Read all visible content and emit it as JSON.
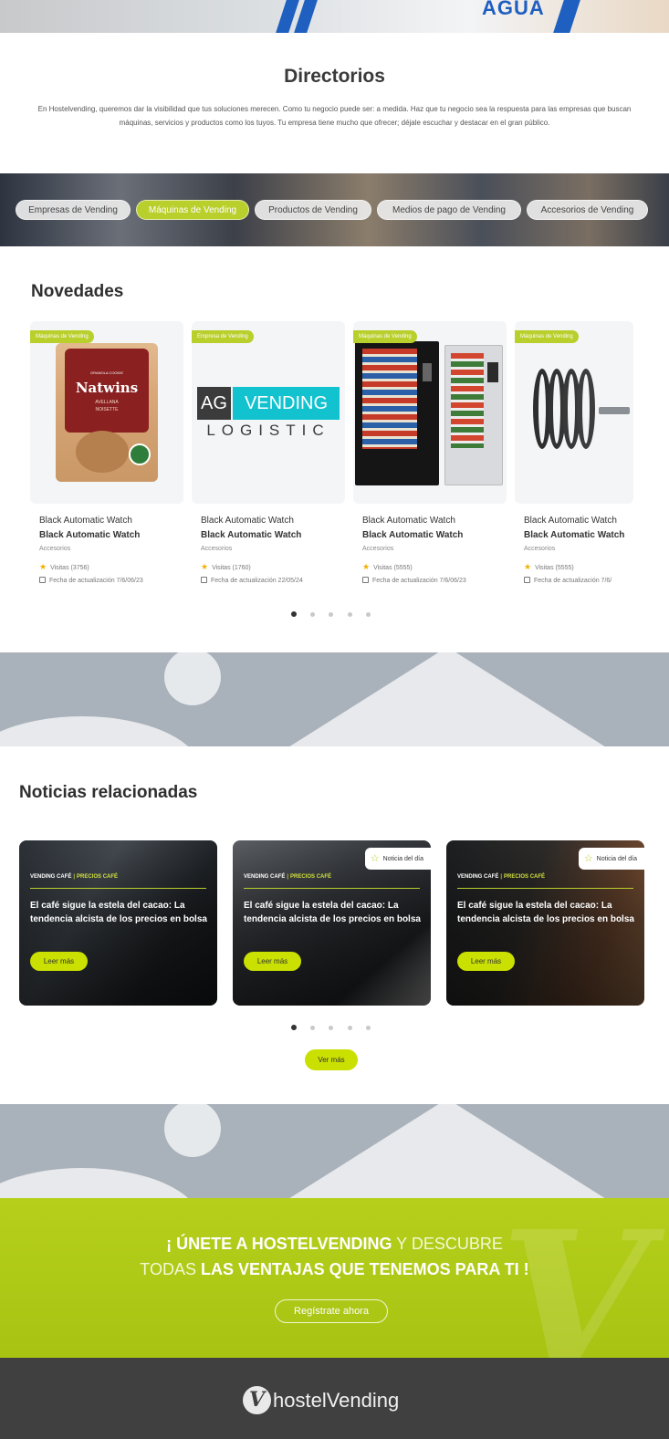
{
  "top_banner": {
    "text": "AGUA"
  },
  "directorios": {
    "title": "Directorios",
    "text": "En Hostelvending, queremos dar la visibilidad que tus soluciones merecen. Como tu negocio puede ser: a medida. Haz que tu negocio sea la respuesta para las empresas que buscan máquinas, servicios y productos como los tuyos. Tu empresa tiene mucho que ofrecer; déjale escuchar y destacar en el gran público."
  },
  "categories": [
    {
      "label": "Empresas de Vending",
      "active": false
    },
    {
      "label": "Máquinas de Vending",
      "active": true
    },
    {
      "label": "Productos de Vending",
      "active": false
    },
    {
      "label": "Medios de pago de Vending",
      "active": false
    },
    {
      "label": "Accesorios de Vending",
      "active": false
    }
  ],
  "novedades": {
    "title": "Novedades",
    "items": [
      {
        "badge": "Máquinas de Vending",
        "title": "Black Automatic Watch",
        "subtitle": "Black Automatic Watch",
        "category": "Accesorios",
        "visits": "Visitas (3756)",
        "date": "Fecha de actualización 7/6/06/23",
        "image": "natwins-product"
      },
      {
        "badge": "Empresa de Vending",
        "title": "Black Automatic Watch",
        "subtitle": "Black Automatic Watch",
        "category": "Accesorios",
        "visits": "Visitas (1760)",
        "date": "Fecha de actualización 22/05/24",
        "image": "ag-vending-logo"
      },
      {
        "badge": "Máquinas de Vending",
        "title": "Black Automatic Watch",
        "subtitle": "Black Automatic Watch",
        "category": "Accesorios",
        "visits": "Visitas (5555)",
        "date": "Fecha de actualización 7/6/06/23",
        "image": "vending-machines"
      },
      {
        "badge": "Máquinas de Vending",
        "title": "Black Automatic Watch",
        "subtitle": "Black Automatic Watch",
        "category": "Accesorios",
        "visits": "Visitas (5555)",
        "date": "Fecha de actualización 7/6/",
        "image": "coil-accessory"
      }
    ],
    "pages": 5,
    "active_page": 1
  },
  "ag_logo": {
    "ag": "AG",
    "vending": "VENDING",
    "logistic": "LOGISTIC"
  },
  "natwins_pack": {
    "top": "GRANOLA COOKIE",
    "brand": "Natwins",
    "flavor1": "AVELLANA",
    "flavor2": "NOISETTE"
  },
  "noticias": {
    "title": "Noticias relacionadas",
    "items": [
      {
        "tag1": "VENDING CAFÉ",
        "tag2": "PRECIOS CAFÉ",
        "title": "El café sigue la estela del cacao: La tendencia alcista de los precios en bolsa",
        "button": "Leer más",
        "day_badge": ""
      },
      {
        "tag1": "VENDING CAFÉ",
        "tag2": "PRECIOS CAFÉ",
        "title": "El café sigue la estela del cacao: La tendencia alcista de los precios en bolsa",
        "button": "Leer más",
        "day_badge": "Noticia del día"
      },
      {
        "tag1": "VENDING CAFÉ",
        "tag2": "PRECIOS CAFÉ",
        "title": "El café sigue la estela del cacao: La tendencia alcista de los precios en bolsa",
        "button": "Leer más",
        "day_badge": "Noticia del día"
      }
    ],
    "pages": 5,
    "active_page": 1,
    "more_button": "Ver más"
  },
  "cta": {
    "line1_bold": "¡ ÚNETE A HOSTELVENDING",
    "line1_rest": " Y DESCUBRE",
    "line2_pre": "TODAS ",
    "line2_bold": "LAS VENTAJAS QUE TENEMOS PARA TI !",
    "button": "Regístrate ahora"
  },
  "footer": {
    "logo_mark": "V",
    "logo_text": "hostelVending"
  },
  "colors": {
    "accent": "#b9cf2c",
    "button": "#c9e000",
    "footer": "#404041",
    "band": "#a9b1ba"
  }
}
